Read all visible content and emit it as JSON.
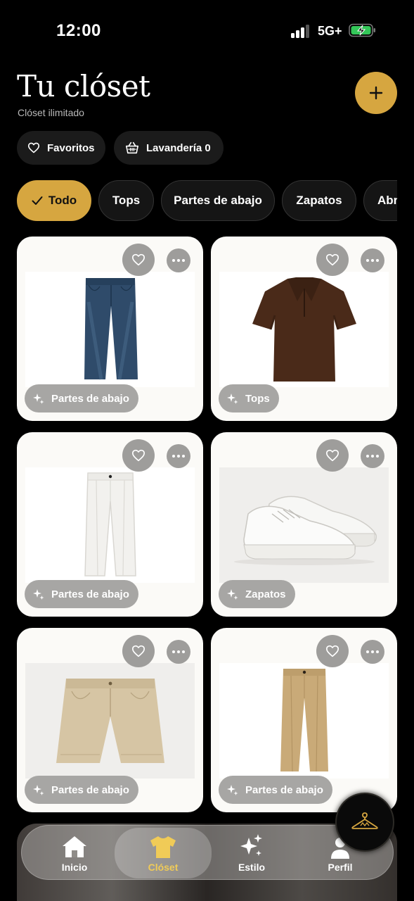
{
  "status_bar": {
    "time": "12:00",
    "network": "5G+"
  },
  "header": {
    "title": "Tu clóset",
    "subtitle": "Clóset ilimitado"
  },
  "quick_filters": {
    "favorites_label": "Favoritos",
    "laundry_label": "Lavandería 0"
  },
  "categories": [
    "Todo",
    "Tops",
    "Partes de abajo",
    "Zapatos",
    "Abr"
  ],
  "items": [
    {
      "category": "Partes de abajo",
      "item": "jeans"
    },
    {
      "category": "Tops",
      "item": "polo"
    },
    {
      "category": "Partes de abajo",
      "item": "white-pants"
    },
    {
      "category": "Zapatos",
      "item": "sneakers"
    },
    {
      "category": "Partes de abajo",
      "item": "shorts"
    },
    {
      "category": "Partes de abajo",
      "item": "khaki-pants"
    }
  ],
  "nav": {
    "home": "Inicio",
    "closet": "Clóset",
    "style": "Estilo",
    "profile": "Perfil"
  },
  "colors": {
    "accent": "#d6a640",
    "active_nav_text": "#f0cb57",
    "background": "#000000"
  }
}
